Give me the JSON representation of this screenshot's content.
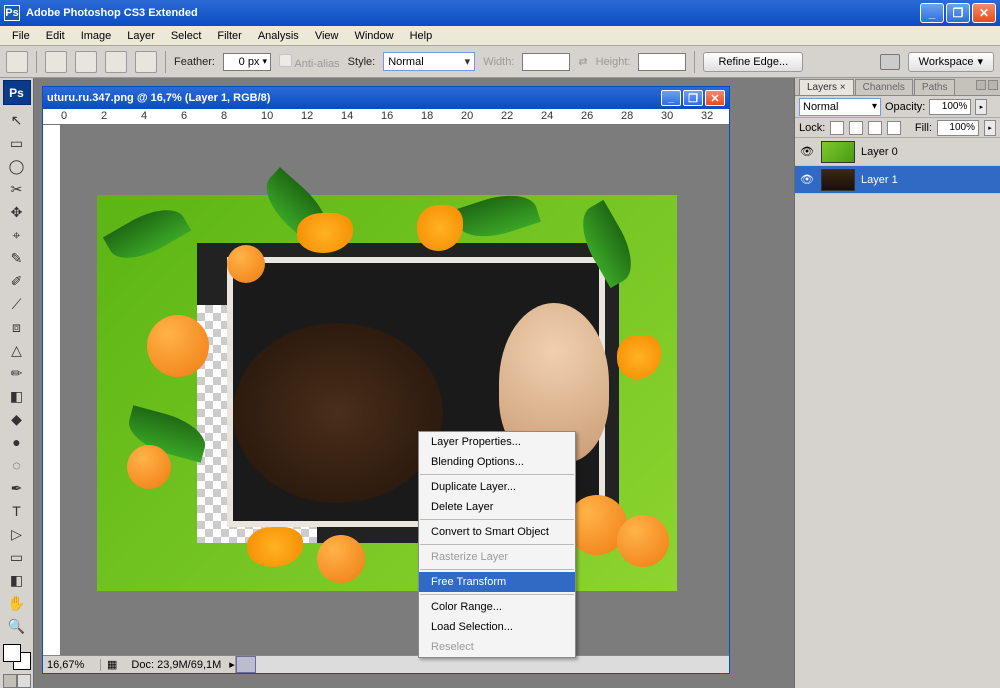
{
  "app": {
    "title": "Adobe Photoshop CS3 Extended"
  },
  "menu": [
    "File",
    "Edit",
    "Image",
    "Layer",
    "Select",
    "Filter",
    "Analysis",
    "View",
    "Window",
    "Help"
  ],
  "opt": {
    "feather_lbl": "Feather:",
    "feather_val": "0 px",
    "aa": "Anti-alias",
    "style_lbl": "Style:",
    "style_val": "Normal",
    "width_lbl": "Width:",
    "height_lbl": "Height:",
    "refine": "Refine Edge...",
    "workspace": "Workspace"
  },
  "doc": {
    "title": "uturu.ru.347.png @ 16,7% (Layer 1, RGB/8)",
    "zoom": "16,67%",
    "info": "Doc: 23,9M/69,1M",
    "ruler": [
      "0",
      "2",
      "4",
      "6",
      "8",
      "10",
      "12",
      "14",
      "16",
      "18",
      "20",
      "22",
      "24",
      "26",
      "28",
      "30",
      "32"
    ]
  },
  "ctx": {
    "items": [
      {
        "t": "Layer Properties..."
      },
      {
        "t": "Blending Options..."
      },
      {
        "sep": true
      },
      {
        "t": "Duplicate Layer..."
      },
      {
        "t": "Delete Layer"
      },
      {
        "sep": true
      },
      {
        "t": "Convert to Smart Object"
      },
      {
        "sep": true
      },
      {
        "t": "Rasterize Layer",
        "dis": true
      },
      {
        "sep": true
      },
      {
        "t": "Free Transform",
        "sel": true
      },
      {
        "sep": true
      },
      {
        "t": "Color Range..."
      },
      {
        "t": "Load Selection..."
      },
      {
        "t": "Reselect",
        "dis": true
      }
    ]
  },
  "layersPanel": {
    "tabs": [
      "Layers ×",
      "Channels",
      "Paths"
    ],
    "mode": "Normal",
    "opacity_lbl": "Opacity:",
    "opacity": "100%",
    "lock_lbl": "Lock:",
    "fill_lbl": "Fill:",
    "fill": "100%",
    "layers": [
      {
        "name": "Layer 0",
        "sel": false
      },
      {
        "name": "Layer 1",
        "sel": true
      }
    ]
  },
  "tools": [
    "↖",
    "▭",
    "◯",
    "✂",
    "✥",
    "⌖",
    "✎",
    "✐",
    "⟋",
    "⧈",
    "△",
    "✏",
    "◧",
    "◆",
    "●",
    "◌",
    "✒",
    "T",
    "▷",
    "▭",
    "◧",
    "✋",
    "🔍"
  ]
}
